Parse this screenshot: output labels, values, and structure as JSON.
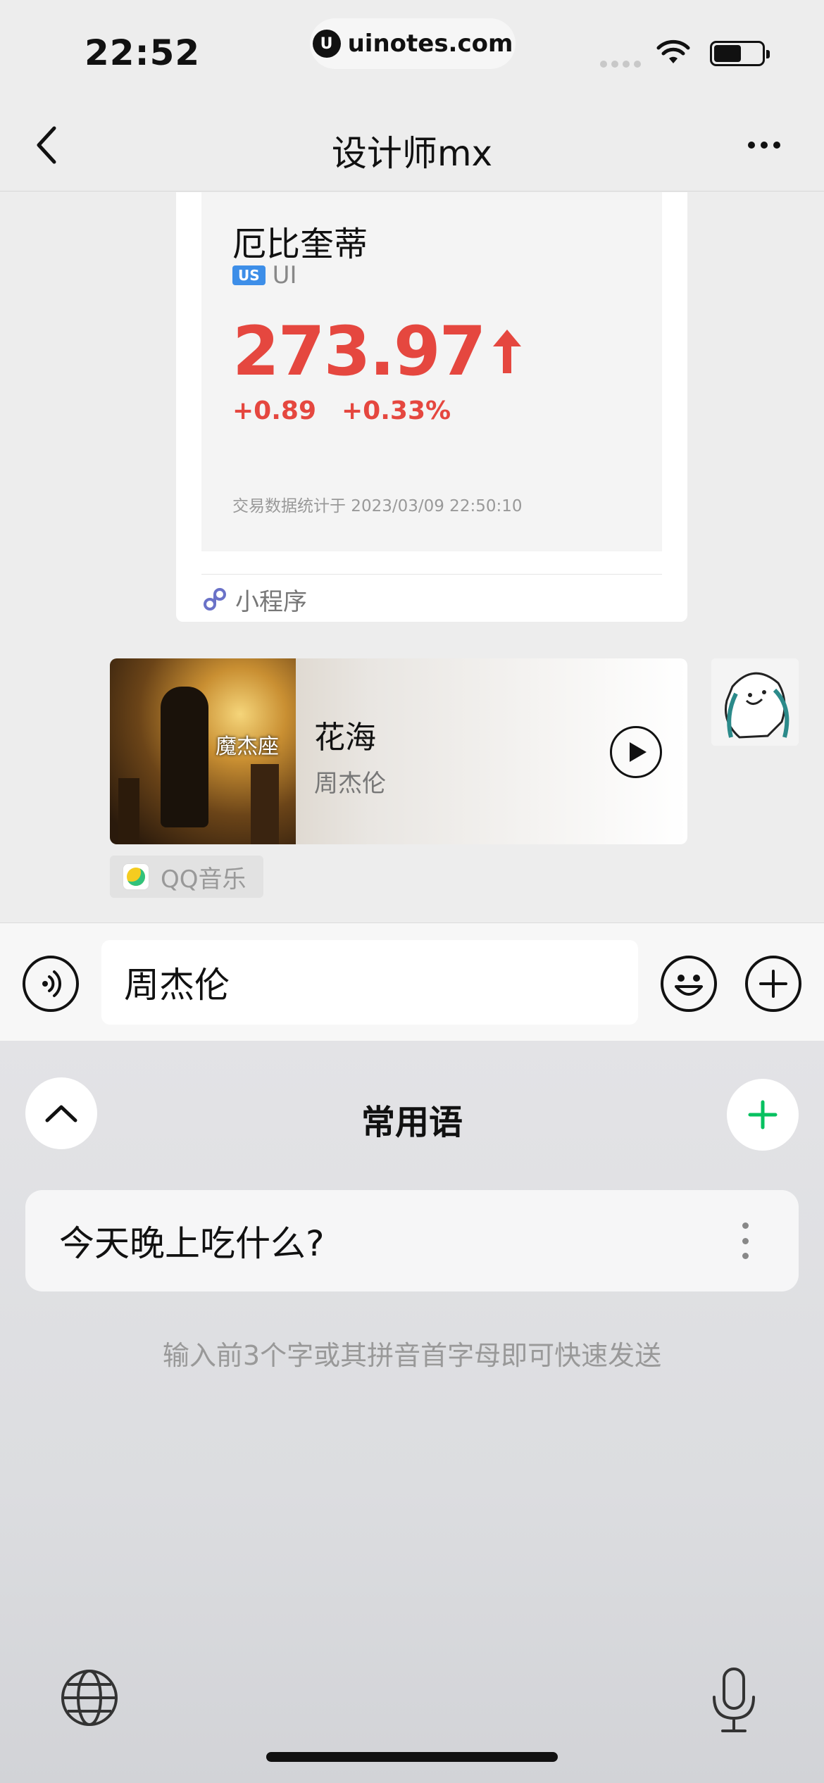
{
  "status_bar": {
    "time": "22:52",
    "url": "uinotes.com"
  },
  "nav": {
    "title": "设计师mx"
  },
  "stock_card": {
    "name": "厄比奎蒂",
    "market_badge": "US",
    "ticker": "UI",
    "price": "273.97",
    "change": "+0.89",
    "change_pct": "+0.33%",
    "stats_note": "交易数据统计于 2023/03/09 22:50:10",
    "footer_label": "小程序",
    "accent_color": "#e5473f"
  },
  "music_card": {
    "song": "花海",
    "artist": "周杰伦",
    "album_caption": "魔杰座",
    "source": "QQ音乐"
  },
  "input": {
    "value": "周杰伦"
  },
  "quick_phrases": {
    "title": "常用语",
    "items": [
      {
        "text": "今天晚上吃什么?"
      }
    ],
    "hint": "输入前3个字或其拼音首字母即可快速发送",
    "accent_color": "#07c160"
  },
  "icons": {
    "back": "chevron-left-icon",
    "more": "more-dots-icon",
    "voice": "voice-icon",
    "emoji": "emoji-icon",
    "plus": "plus-icon",
    "collapse": "chevron-up-icon",
    "add": "plus-icon",
    "globe": "globe-icon",
    "mic": "microphone-icon"
  }
}
